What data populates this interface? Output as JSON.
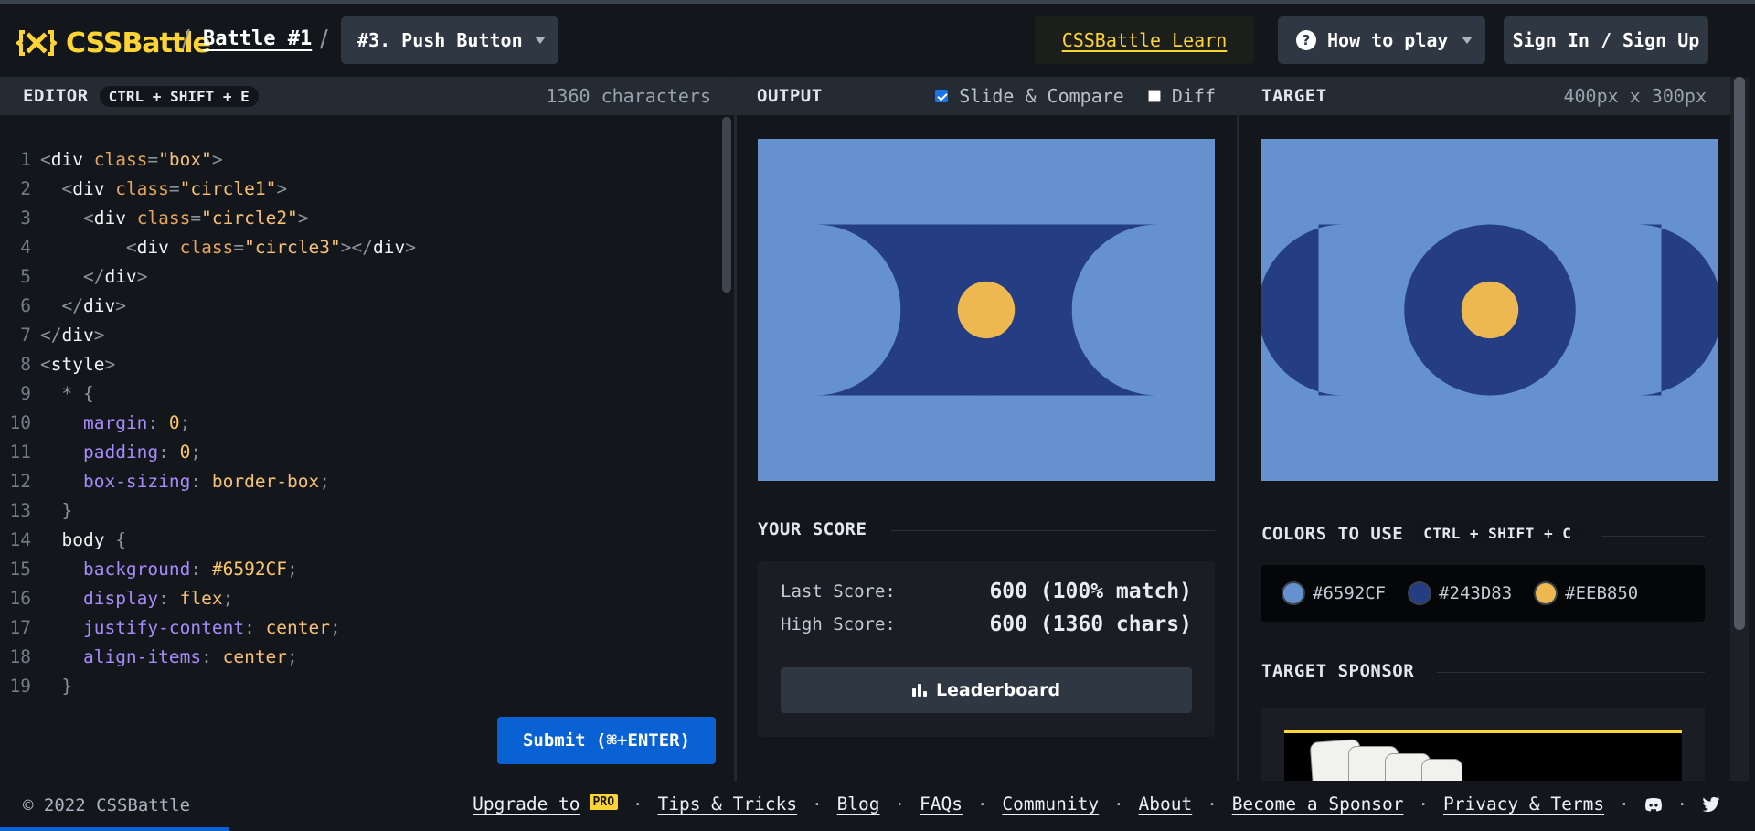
{
  "header": {
    "logo_text": "CSSBattle",
    "battle_label": "Battle #1",
    "level_select": "#3. Push Button",
    "learn_link": "CSSBattle Learn",
    "how_to_play": "How to play",
    "sign_in": "Sign In / Sign Up",
    "brand_color": "#fcd535"
  },
  "editor": {
    "title": "EDITOR",
    "shortcut": "CTRL + SHIFT + E",
    "char_count": "1360 characters",
    "submit_label": "Submit (⌘+ENTER)",
    "lines": [
      {
        "n": "1",
        "tokens": [
          [
            "t-punc",
            "<"
          ],
          [
            "t-tag",
            "div "
          ],
          [
            "t-attr",
            "class"
          ],
          [
            "t-punc",
            "="
          ],
          [
            "t-str",
            "\"box\""
          ],
          [
            "t-punc",
            ">"
          ]
        ]
      },
      {
        "n": "2",
        "tokens": [
          [
            "src",
            "  "
          ],
          [
            "t-punc",
            "<"
          ],
          [
            "t-tag",
            "div "
          ],
          [
            "t-attr",
            "class"
          ],
          [
            "t-punc",
            "="
          ],
          [
            "t-str",
            "\"circle1\""
          ],
          [
            "t-punc",
            ">"
          ]
        ]
      },
      {
        "n": "3",
        "tokens": [
          [
            "src",
            "    "
          ],
          [
            "t-punc",
            "<"
          ],
          [
            "t-tag",
            "div "
          ],
          [
            "t-attr",
            "class"
          ],
          [
            "t-punc",
            "="
          ],
          [
            "t-str",
            "\"circle2\""
          ],
          [
            "t-punc",
            ">"
          ]
        ]
      },
      {
        "n": "4",
        "tokens": [
          [
            "src",
            "        "
          ],
          [
            "t-punc",
            "<"
          ],
          [
            "t-tag",
            "div "
          ],
          [
            "t-attr",
            "class"
          ],
          [
            "t-punc",
            "="
          ],
          [
            "t-str",
            "\"circle3\""
          ],
          [
            "t-punc",
            "></"
          ],
          [
            "t-tag",
            "div"
          ],
          [
            "t-punc",
            ">"
          ]
        ]
      },
      {
        "n": "5",
        "tokens": [
          [
            "src",
            "    "
          ],
          [
            "t-punc",
            "</"
          ],
          [
            "t-tag",
            "div"
          ],
          [
            "t-punc",
            ">"
          ]
        ]
      },
      {
        "n": "6",
        "tokens": [
          [
            "src",
            "  "
          ],
          [
            "t-punc",
            "</"
          ],
          [
            "t-tag",
            "div"
          ],
          [
            "t-punc",
            ">"
          ]
        ]
      },
      {
        "n": "7",
        "tokens": [
          [
            "t-punc",
            "</"
          ],
          [
            "t-tag",
            "div"
          ],
          [
            "t-punc",
            ">"
          ]
        ]
      },
      {
        "n": "8",
        "tokens": [
          [
            "t-punc",
            "<"
          ],
          [
            "t-tag",
            "style"
          ],
          [
            "t-punc",
            ">"
          ]
        ]
      },
      {
        "n": "9",
        "tokens": [
          [
            "src",
            "  "
          ],
          [
            "t-punc",
            "* {"
          ]
        ]
      },
      {
        "n": "10",
        "tokens": [
          [
            "src",
            "    "
          ],
          [
            "t-prop",
            "margin"
          ],
          [
            "t-punc",
            ": "
          ],
          [
            "t-num",
            "0"
          ],
          [
            "t-punc",
            ";"
          ]
        ]
      },
      {
        "n": "11",
        "tokens": [
          [
            "src",
            "    "
          ],
          [
            "t-prop",
            "padding"
          ],
          [
            "t-punc",
            ": "
          ],
          [
            "t-num",
            "0"
          ],
          [
            "t-punc",
            ";"
          ]
        ]
      },
      {
        "n": "12",
        "tokens": [
          [
            "src",
            "    "
          ],
          [
            "t-prop",
            "box-sizing"
          ],
          [
            "t-punc",
            ": "
          ],
          [
            "t-val",
            "border-box"
          ],
          [
            "t-punc",
            ";"
          ]
        ]
      },
      {
        "n": "13",
        "tokens": [
          [
            "src",
            "  "
          ],
          [
            "t-punc",
            "}"
          ]
        ]
      },
      {
        "n": "14",
        "tokens": [
          [
            "src",
            "  "
          ],
          [
            "t-sel",
            "body "
          ],
          [
            "t-punc",
            "{"
          ]
        ]
      },
      {
        "n": "15",
        "tokens": [
          [
            "src",
            "    "
          ],
          [
            "t-prop",
            "background"
          ],
          [
            "t-punc",
            ": "
          ],
          [
            "t-num",
            "#6592CF"
          ],
          [
            "t-punc",
            ";"
          ]
        ]
      },
      {
        "n": "16",
        "tokens": [
          [
            "src",
            "    "
          ],
          [
            "t-prop",
            "display"
          ],
          [
            "t-punc",
            ": "
          ],
          [
            "t-val",
            "flex"
          ],
          [
            "t-punc",
            ";"
          ]
        ]
      },
      {
        "n": "17",
        "tokens": [
          [
            "src",
            "    "
          ],
          [
            "t-prop",
            "justify-content"
          ],
          [
            "t-punc",
            ": "
          ],
          [
            "t-val",
            "center"
          ],
          [
            "t-punc",
            ";"
          ]
        ]
      },
      {
        "n": "18",
        "tokens": [
          [
            "src",
            "    "
          ],
          [
            "t-prop",
            "align-items"
          ],
          [
            "t-punc",
            ": "
          ],
          [
            "t-val",
            "center"
          ],
          [
            "t-punc",
            ";"
          ]
        ]
      },
      {
        "n": "19",
        "tokens": [
          [
            "src",
            "  "
          ],
          [
            "t-punc",
            "}"
          ]
        ]
      }
    ]
  },
  "output": {
    "title": "OUTPUT",
    "slide_compare": "Slide & Compare",
    "slide_compare_checked": true,
    "diff": "Diff",
    "diff_checked": false
  },
  "target": {
    "title": "TARGET",
    "dims": "400px x 300px"
  },
  "score": {
    "title": "YOUR SCORE",
    "last_label": "Last Score:",
    "last_value": "600 (100% match)",
    "high_label": "High Score:",
    "high_value": "600 (1360 chars)",
    "leaderboard": "Leaderboard"
  },
  "colors": {
    "title": "COLORS TO USE",
    "shortcut": "CTRL + SHIFT + C",
    "items": [
      {
        "hex": "#6592CF"
      },
      {
        "hex": "#243D83"
      },
      {
        "hex": "#EEB850"
      }
    ]
  },
  "sponsor": {
    "title": "TARGET SPONSOR"
  },
  "footer": {
    "copyright": "© 2022 CSSBattle",
    "upgrade": "Upgrade to",
    "pro_badge": "PRO",
    "tips": "Tips & Tricks",
    "blog": "Blog",
    "faqs": "FAQs",
    "community": "Community",
    "about": "About",
    "sponsor": "Become a Sponsor",
    "privacy": "Privacy & Terms",
    "icons": [
      "discord-icon",
      "twitter-icon"
    ]
  }
}
